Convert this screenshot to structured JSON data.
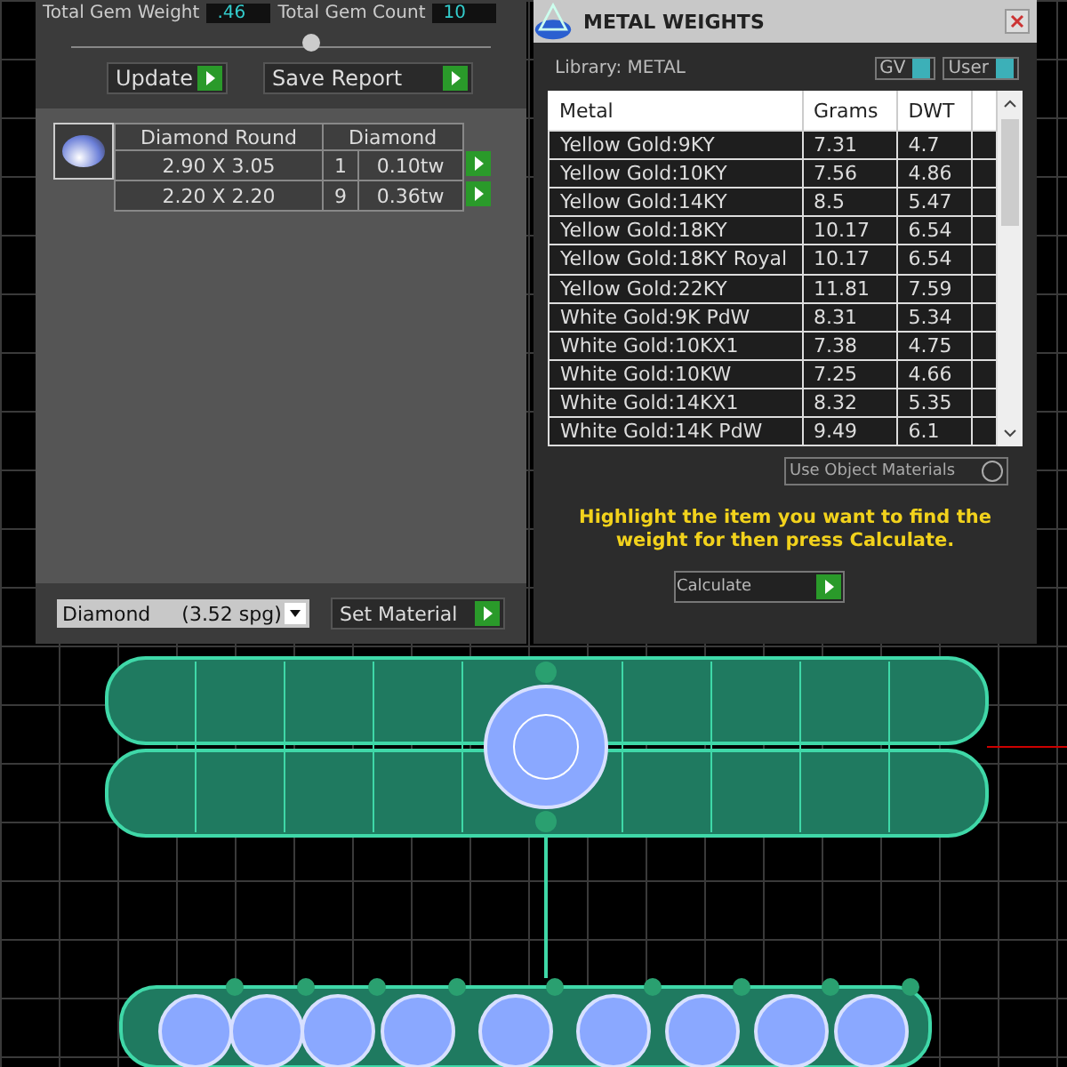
{
  "gem_panel": {
    "totals": [
      {
        "label": "Total Gem Weight",
        "value": ".46"
      },
      {
        "label": "Total Gem Count",
        "value": "10"
      }
    ],
    "buttons": [
      "Update",
      "Save Report"
    ],
    "gem_table": {
      "columns": [
        "Diamond Round",
        "Diamond"
      ],
      "rows": [
        {
          "size": "2.90 X 3.05",
          "count": "1",
          "weight": "0.10tw"
        },
        {
          "size": "2.20 X 2.20",
          "count": "9",
          "weight": "0.36tw"
        }
      ]
    },
    "material_select": {
      "value": "Diamond     (3.52 spg)"
    },
    "set_material_button": "Set Material"
  },
  "metal_window": {
    "title": "METAL WEIGHTS",
    "library": "Library: METAL",
    "toggles": [
      {
        "label": "GV",
        "on": true
      },
      {
        "label": "User",
        "on": true
      }
    ],
    "table": {
      "columns": [
        "Metal",
        "Grams",
        "DWT"
      ],
      "rows": [
        {
          "metal": "Yellow Gold:9KY",
          "grams": "7.31",
          "dwt": "4.7"
        },
        {
          "metal": "Yellow Gold:10KY",
          "grams": "7.56",
          "dwt": "4.86"
        },
        {
          "metal": "Yellow Gold:14KY",
          "grams": "8.5",
          "dwt": "5.47"
        },
        {
          "metal": "Yellow Gold:18KY",
          "grams": "10.17",
          "dwt": "6.54"
        },
        {
          "metal": "Yellow Gold:18KY Royal",
          "grams": "10.17",
          "dwt": "6.54"
        },
        {
          "metal": "Yellow Gold:22KY",
          "grams": "11.81",
          "dwt": "7.59"
        },
        {
          "metal": "White Gold:9K PdW",
          "grams": "8.31",
          "dwt": "5.34"
        },
        {
          "metal": "White Gold:10KX1",
          "grams": "7.38",
          "dwt": "4.75"
        },
        {
          "metal": "White Gold:10KW",
          "grams": "7.25",
          "dwt": "4.66"
        },
        {
          "metal": "White Gold:14KX1",
          "grams": "8.32",
          "dwt": "5.35"
        },
        {
          "metal": "White Gold:14K PdW",
          "grams": "9.49",
          "dwt": "6.1"
        }
      ]
    },
    "source_select": {
      "value": "Use Object Materials"
    },
    "hint": "Highlight the item you want to find the weight for then press Calculate.",
    "action_select": {
      "value": "Calculate"
    }
  }
}
